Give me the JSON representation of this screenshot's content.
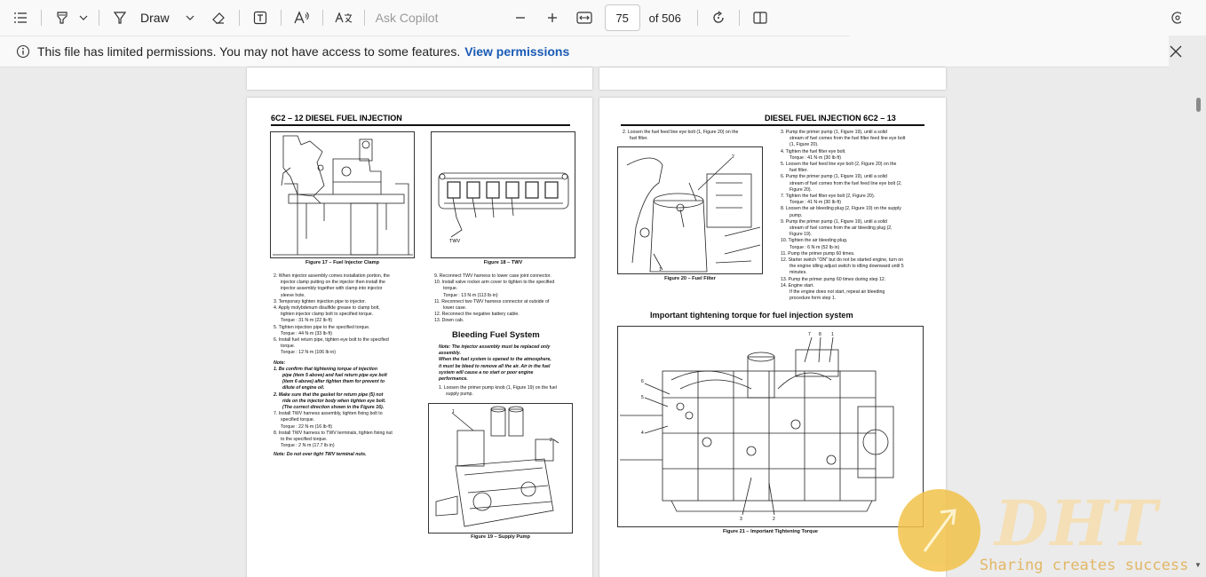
{
  "toolbar": {
    "draw_label": "Draw",
    "ask_placeholder": "Ask Copilot",
    "page_number": "75",
    "page_total": "of 506"
  },
  "infobar": {
    "message": "This file has limited permissions. You may not have access to some features.",
    "link": "View permissions"
  },
  "left_page": {
    "header": "6C2 – 12  DIESEL FUEL INJECTION",
    "fig17_caption": "Figure 17 – Fuel Injector Clamp",
    "fig18_caption": "Figure 18 – TWV",
    "fig18_label": "TWV",
    "fig19_caption": "Figure 19 – Supply Pump",
    "col1": [
      "2. When injector assembly comes installation portion, the",
      "injector clamp putting on the injector then install the",
      "injector assembly together with clamp into injector",
      "sleeve hole.",
      "3. Temporary tighten injection pipe to injector.",
      "4. Apply molybdenum disulfide grease to clamp bolt,",
      "tighten injector clamp bolt to specified torque.",
      "Torque :       31 N·m (22 lb·ft)",
      "5. Tighten injection pipe to the specified torque.",
      "Torque :       44 N·m (33 lb·ft)",
      "6. Install fuel return pipe, tighten eye bolt to the specified",
      "torque.",
      "Torque :       12 N·m (106 lb·in)"
    ],
    "note_title": "Note:",
    "notes": [
      "1.  Be confirm that tightening torque of injection",
      "pipe (item 5 above) and fuel return pipe eye bolt",
      "(item 6 above) after tighten them for prevent to",
      "dilute of engine oil.",
      "2.  Make sure that the gasket for return pipe (5) not",
      "ride on the injector body when tighten eye bolt.",
      "(The correct direction shown in the Figure 16)."
    ],
    "col1_b": [
      "7. Install TWV harness assembly, tighten fixing bolt to",
      "specified torque.",
      "Torque :       22 N·m (16 lb·ft)",
      "8. Install TWV harness to TWV terminals, tighten fixing nut",
      "to the specified torque.",
      "Torque :       2 N·m (17.7 lb·in)"
    ],
    "note_twv": "Note: Do not over tight TWV terminal nuts.",
    "col2": [
      "9. Reconnect TWV harness to lower case joint connector.",
      "10. Install valve rocker arm cover to tighten to the specified",
      "torque.",
      "Torque :       13 N·m (113 lb·in)",
      "11. Reconnect two TWV harness connector at outside of",
      "lower case.",
      "12. Reconnect the negative battery cable.",
      "13. Down cab."
    ],
    "bleed_title": "Bleeding Fuel System",
    "bleed_note": [
      "Note: The injector assembly must be replaced only",
      "assembly.",
      "When the fuel system is opened to the atmosphere,",
      "it must be bleed to remove all the air. Air in the fuel",
      "system will cause a no start or poor engine",
      "performance."
    ],
    "bleed_step": [
      "1. Loosen the primer pump knob (1, Figure 19) on the fuel",
      "supply pump."
    ]
  },
  "right_page": {
    "header": "DIESEL FUEL INJECTION  6C2 – 13",
    "step2": [
      "2. Loosen the fuel feed line eye bolt (1, Figure 20) on the",
      "fuel filter."
    ],
    "fig20_caption": "Figure 20 – Fuel Filter",
    "col2": [
      "3. Pump the primer pump (1, Figure 19), until a solid",
      "stream of fuel comes from the fuel filter feed line eye bolt",
      "(1, Figure 20).",
      "4. Tighten the fuel filter eye bolt.",
      "Torque :       41 N·m (30 lb·ft)",
      "5. Loosen the fuel feed line eye bolt (2, Figure 20) on the",
      "fuel filter.",
      "6. Pump the primer pump (1, Figure 19), until a solid",
      "stream of fuel comes from the fuel feed line eye bolt (2,",
      "Figure 20).",
      "7. Tighten the fuel filter eye bolt (2, Figure 20).",
      "Torque :       41 N·m (30 lb·ft)",
      "8. Loosen the air bleeding plug (2, Figure 19) on the supply",
      "pump.",
      "9. Pump the primer pump (1, Figure 19), until a solid",
      "stream of fuel comes from the air bleeding plug (2,",
      "Figure 19).",
      "10. Tighten the air bleeding plug.",
      "Torque :       6 N·m (52 lb·in)",
      "11. Pump the primer pump 60 times.",
      "12. Starter switch \"ON\" but do not be started engine, turn on",
      "the engine idling adjust switch to idling downward until 5",
      "minutes.",
      "13. Pump the primer pump 60 times during step 12.",
      "14. Engine start.",
      "If the engine does not start, repeat air bleeding",
      "procedure form step 1."
    ],
    "torque_title": "Important tightening torque for fuel injection system",
    "fig21_caption": "Figure 21 – Important Tightening Torque"
  },
  "watermark": {
    "text": "DHT",
    "sub": "Sharing creates success"
  }
}
